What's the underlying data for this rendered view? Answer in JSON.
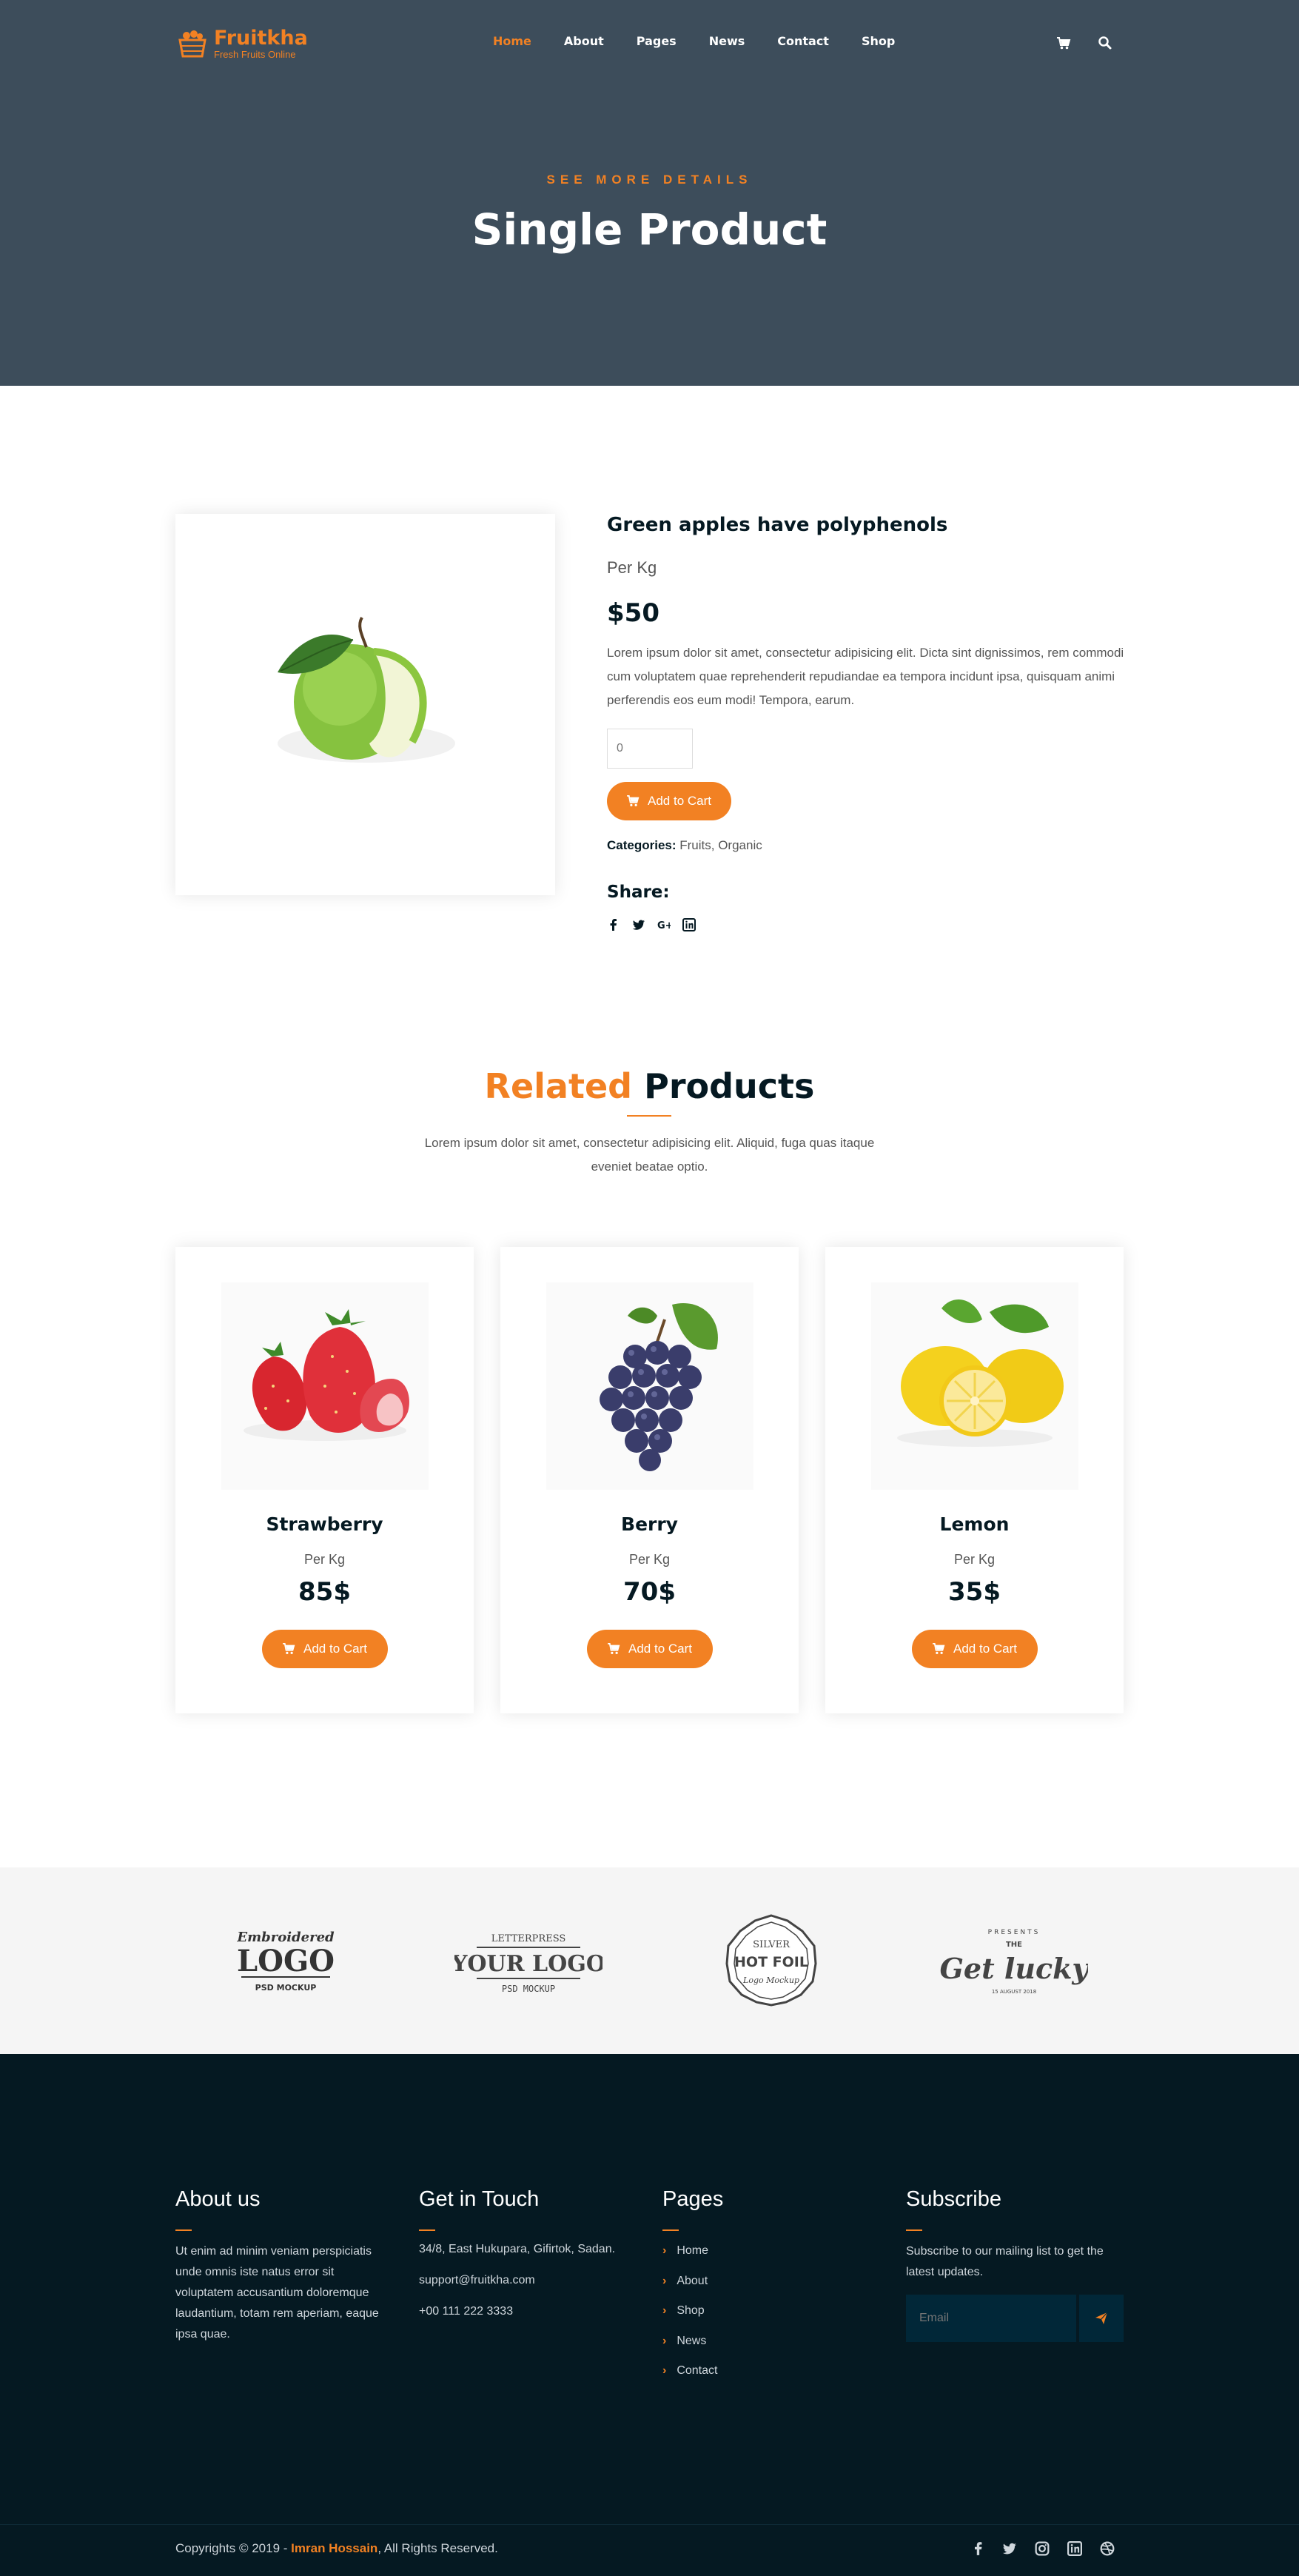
{
  "header": {
    "logo_title": "Fruitkha",
    "logo_subtitle": "Fresh Fruits Online",
    "nav": [
      "Home",
      "About",
      "Pages",
      "News",
      "Contact",
      "Shop"
    ],
    "active_nav": "Home",
    "icons": [
      "cart-icon",
      "search-icon"
    ]
  },
  "hero": {
    "subtitle": "SEE MORE DETAILS",
    "title": "Single Product"
  },
  "product": {
    "name": "Green apples have polyphenols",
    "unit": "Per Kg",
    "price": "$50",
    "description": "Lorem ipsum dolor sit amet, consectetur adipisicing elit. Dicta sint dignissimos, rem commodi cum voluptatem quae reprehenderit repudiandae ea tempora incidunt ipsa, quisquam animi perferendis eos eum modi! Tempora, earum.",
    "quantity_placeholder": "0",
    "add_to_cart": "Add to Cart",
    "categories_label": "Categories:",
    "categories": "Fruits, Organic",
    "share_label": "Share:",
    "share_icons": [
      "facebook-icon",
      "twitter-icon",
      "google-plus-icon",
      "linkedin-icon"
    ]
  },
  "related": {
    "title_highlight": "Related",
    "title_rest": "Products",
    "description": "Lorem ipsum dolor sit amet, consectetur adipisicing elit. Aliquid, fuga quas itaque eveniet beatae optio.",
    "items": [
      {
        "name": "Strawberry",
        "unit": "Per Kg",
        "price": "85$",
        "button": "Add to Cart"
      },
      {
        "name": "Berry",
        "unit": "Per Kg",
        "price": "70$",
        "button": "Add to Cart"
      },
      {
        "name": "Lemon",
        "unit": "Per Kg",
        "price": "35$",
        "button": "Add to Cart"
      }
    ]
  },
  "brands": {
    "embroidered": {
      "top": "Embroidered",
      "main": "LOGO",
      "bottom": "PSD MOCKUP"
    },
    "letterpress": {
      "top": "LETTERPRESS",
      "main": "YOUR LOGO",
      "bottom": "PSD MOCKUP"
    },
    "hotfoil": {
      "top": "SILVER",
      "main": "HOT FOIL",
      "bottom": "Logo Mockup"
    },
    "getlucky": {
      "top": "PRESENTS",
      "mid": "THE",
      "main": "Get lucky",
      "bottom": "15 AUGUST 2018"
    }
  },
  "footer": {
    "about_title": "About us",
    "about_text": "Ut enim ad minim veniam perspiciatis unde omnis iste natus error sit voluptatem accusantium doloremque laudantium, totam rem aperiam, eaque ipsa quae.",
    "contact_title": "Get in Touch",
    "address": "34/8, East Hukupara, Gifirtok, Sadan.",
    "email": "support@fruitkha.com",
    "phone": "+00 111 222 3333",
    "pages_title": "Pages",
    "pages": [
      "Home",
      "About",
      "Shop",
      "News",
      "Contact"
    ],
    "subscribe_title": "Subscribe",
    "subscribe_text": "Subscribe to our mailing list to get the latest updates.",
    "email_placeholder": "Email",
    "copyright_prefix": "Copyrights © 2019 - ",
    "copyright_name": "Imran Hossain",
    "copyright_suffix": ",  All Rights Reserved.",
    "social_icons": [
      "facebook-icon",
      "twitter-icon",
      "instagram-icon",
      "linkedin-icon",
      "dribbble-icon"
    ]
  },
  "colors": {
    "accent": "#f28123",
    "hero_bg": "#3d4d5b",
    "dark": "#051922",
    "footer_input_bg": "#012738"
  }
}
